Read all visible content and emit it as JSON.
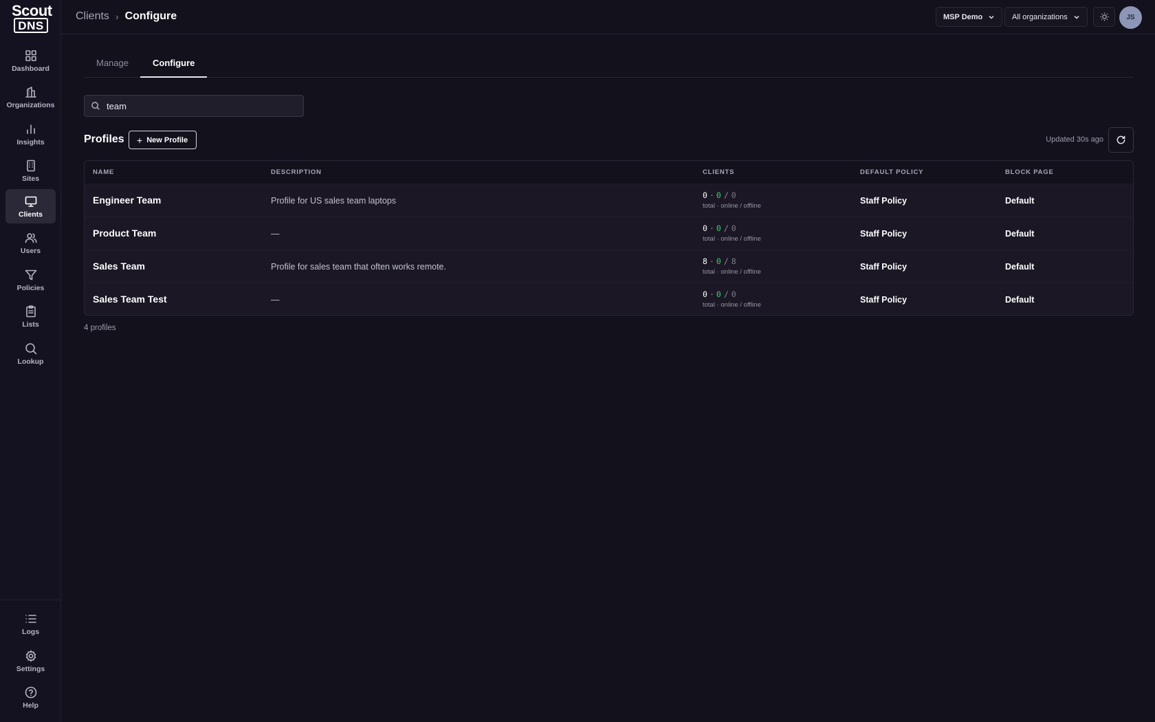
{
  "brand": {
    "line1": "Scout",
    "line2": "DNS"
  },
  "sidebar": {
    "items": [
      {
        "label": "Dashboard",
        "icon": "grid-icon"
      },
      {
        "label": "Organizations",
        "icon": "building-icon"
      },
      {
        "label": "Insights",
        "icon": "bar-chart-icon"
      },
      {
        "label": "Sites",
        "icon": "site-icon"
      },
      {
        "label": "Clients",
        "icon": "monitor-icon",
        "active": true
      },
      {
        "label": "Users",
        "icon": "users-icon"
      },
      {
        "label": "Policies",
        "icon": "filter-icon"
      },
      {
        "label": "Lists",
        "icon": "clipboard-icon"
      },
      {
        "label": "Lookup",
        "icon": "search-icon"
      }
    ],
    "bottom_items": [
      {
        "label": "Logs",
        "icon": "list-icon"
      },
      {
        "label": "Settings",
        "icon": "gear-icon"
      },
      {
        "label": "Help",
        "icon": "help-icon"
      }
    ]
  },
  "header": {
    "breadcrumb": [
      "Clients",
      "Configure"
    ],
    "tenant_selector": "MSP Demo",
    "org_selector": "All organizations",
    "avatar_initials": "JS"
  },
  "tabs": [
    {
      "label": "Manage",
      "active": false
    },
    {
      "label": "Configure",
      "active": true
    }
  ],
  "search": {
    "value": "team",
    "placeholder": ""
  },
  "profiles": {
    "title": "Profiles",
    "new_button": "New Profile",
    "updated": "Updated 30s ago",
    "columns": [
      "NAME",
      "DESCRIPTION",
      "CLIENTS",
      "DEFAULT POLICY",
      "BLOCK PAGE"
    ],
    "clients_caption": "total · online / offline",
    "rows": [
      {
        "name": "Engineer Team",
        "description": "Profile for US sales team laptops",
        "total": "0",
        "online": "0",
        "offline": "0",
        "policy": "Staff Policy",
        "block_page": "Default"
      },
      {
        "name": "Product Team",
        "description": "—",
        "total": "0",
        "online": "0",
        "offline": "0",
        "policy": "Staff Policy",
        "block_page": "Default"
      },
      {
        "name": "Sales Team",
        "description": "Profile for sales team that often works remote.",
        "total": "8",
        "online": "0",
        "offline": "8",
        "policy": "Staff Policy",
        "block_page": "Default"
      },
      {
        "name": "Sales Team Test",
        "description": "—",
        "total": "0",
        "online": "0",
        "offline": "0",
        "policy": "Staff Policy",
        "block_page": "Default"
      }
    ],
    "count_label": "4 profiles"
  },
  "colors": {
    "background": "#13111c",
    "online": "#3ecf6e",
    "active_nav": "#2b2838"
  }
}
